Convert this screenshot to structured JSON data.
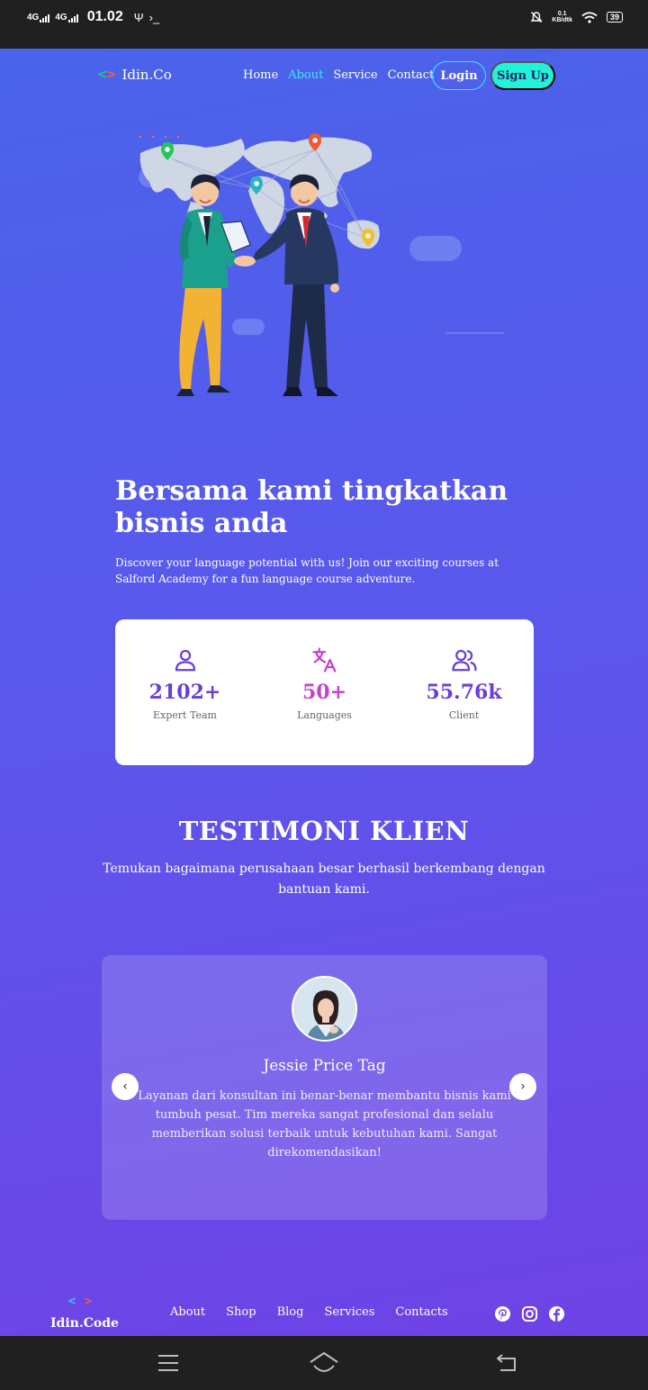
{
  "status_bar": {
    "net1": "4G",
    "net2": "4G",
    "time": "01.02",
    "usb_symbol": "Ψ",
    "terminal_symbol": "›_",
    "speed_value": "0.1",
    "speed_unit": "KB/dtk",
    "battery": "39"
  },
  "nav": {
    "brand": "Idin.Co",
    "links": [
      "Home",
      "About",
      "Service",
      "Contact"
    ],
    "active_link": "About",
    "login": "Login",
    "signup": "Sign Up"
  },
  "hero": {
    "title": "Bersama kami tingkatkan bisnis anda",
    "description": "Discover your language potential with us! Join our exciting courses at Salford Academy for a fun language course adventure."
  },
  "stats": [
    {
      "icon": "user-icon",
      "value": "2102+",
      "label": "Expert Team",
      "color": "#6a3fd6"
    },
    {
      "icon": "translate-icon",
      "value": "50+",
      "label": "Languages",
      "color": "#c545c8"
    },
    {
      "icon": "users-icon",
      "value": "55.76k",
      "label": "Client",
      "color": "#6a3fd6"
    }
  ],
  "testimonials": {
    "title": "TESTIMONI KLIEN",
    "subtitle": "Temukan bagaimana perusahaan besar berhasil berkembang dengan bantuan kami.",
    "name": "Jessie Price Tag",
    "text": "Layanan dari konsultan ini benar-benar membantu bisnis kami tumbuh pesat. Tim mereka sangat profesional dan selalu memberikan solusi terbaik untuk kebutuhan kami. Sangat direkomendasikan!",
    "prev": "‹",
    "next": "›"
  },
  "footer": {
    "brand": "Idin.Code",
    "links": [
      "About",
      "Shop",
      "Blog",
      "Services",
      "Contacts"
    ],
    "social": [
      "pinterest-icon",
      "instagram-icon",
      "facebook-icon"
    ]
  },
  "colors": {
    "accent_cyan": "#41e6ff",
    "signup_bg": "#22f2da",
    "stat_purple": "#6a3fd6",
    "stat_pink": "#c545c8"
  }
}
